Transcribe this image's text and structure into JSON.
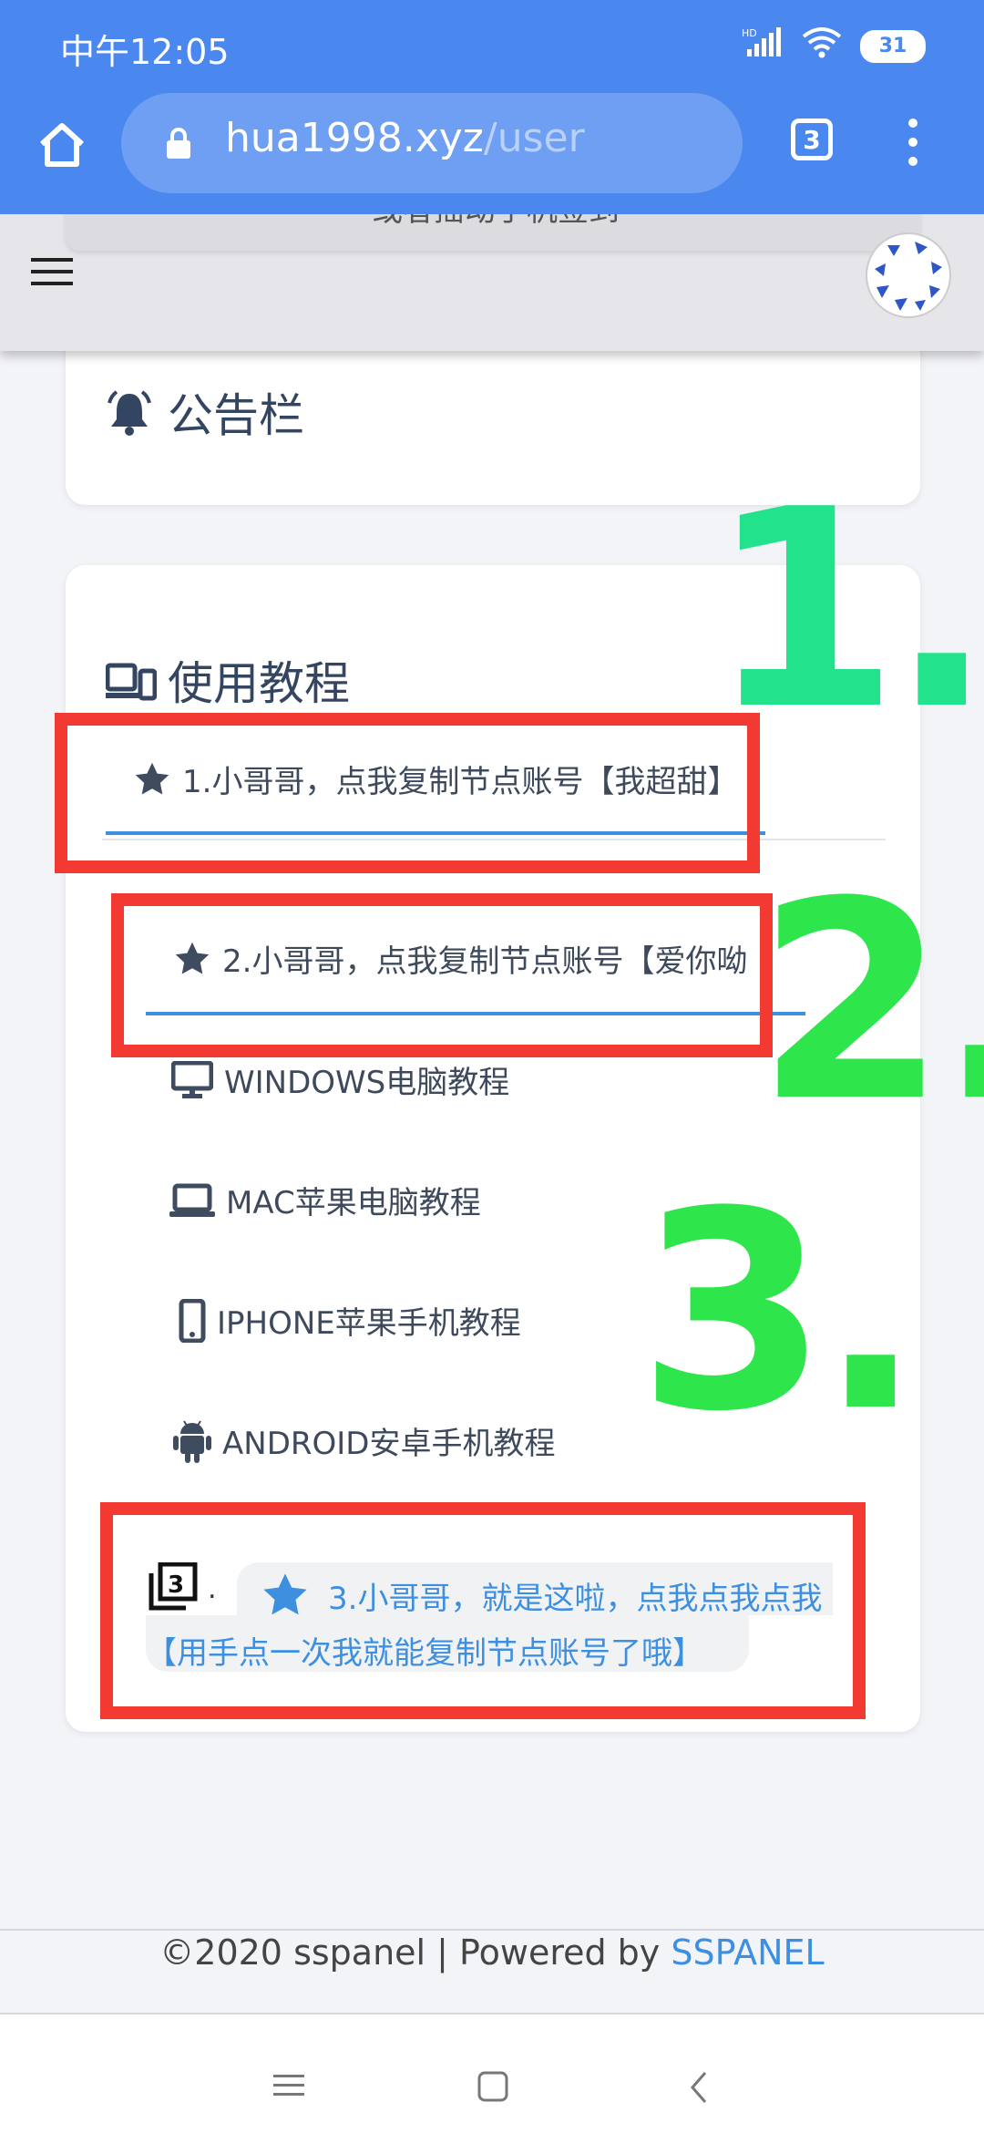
{
  "status_bar": {
    "time": "中午12:05",
    "hd_label": "HD",
    "battery": "31"
  },
  "browser": {
    "domain": "hua1998.xyz",
    "path": "/user",
    "tab_count": "3"
  },
  "sticky_header": {
    "partial_text": "或者摇动手机签到"
  },
  "announcement": {
    "title": "公告栏"
  },
  "tutorial": {
    "title": "使用教程",
    "items": [
      {
        "label": "1.小哥哥，点我复制节点账号【我超甜】"
      },
      {
        "label": "2.小哥哥，点我复制节点账号【爱你呦"
      },
      {
        "label": "WINDOWS电脑教程"
      },
      {
        "label": "MAC苹果电脑教程"
      },
      {
        "label": "IPHONE苹果手机教程"
      },
      {
        "label": "ANDROID安卓手机教程"
      }
    ],
    "special_prefix": ".",
    "special_line1": "3.小哥哥，就是这啦，点我点我点我",
    "special_line2": "【用手点一次我就能复制节点账号了哦】"
  },
  "annotations": {
    "n1": "1.",
    "n2": "2.",
    "n3": "3."
  },
  "footer": {
    "copyright": "©2020 sspanel | Powered by ",
    "brand": "SSPANEL"
  },
  "colors": {
    "browser_bar": "#4a87ee",
    "annotation_red": "#f23a33",
    "annotation_green_1": "#22e38b",
    "annotation_green_2": "#2ee64c",
    "link_blue": "#3d8fe0"
  }
}
